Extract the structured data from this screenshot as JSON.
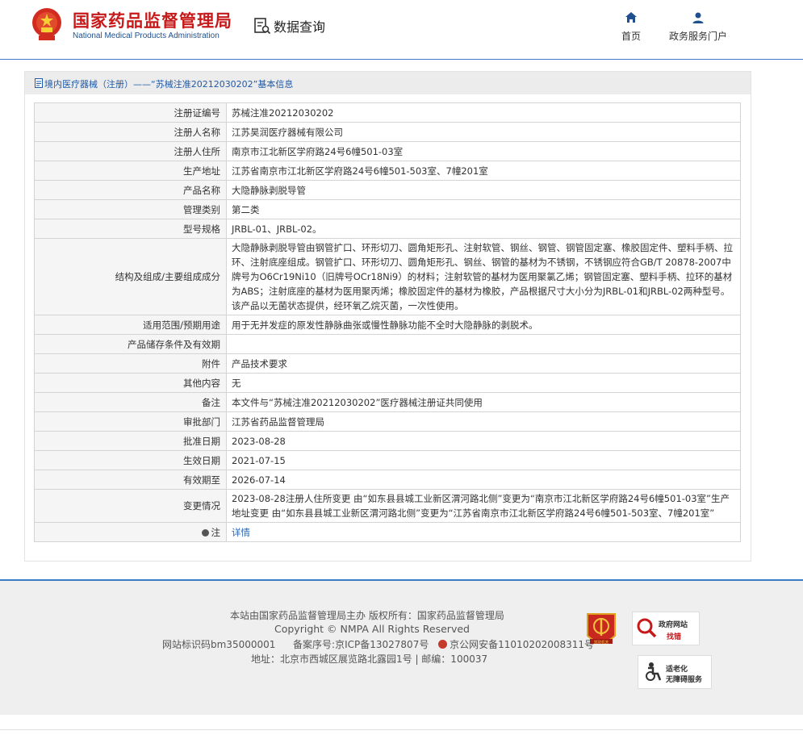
{
  "header": {
    "logo_cn": "国家药品监督管理局",
    "logo_en": "National Medical Products Administration",
    "section_label": "数据查询",
    "nav": [
      {
        "label": "首页",
        "icon": "home-icon"
      },
      {
        "label": "政务服务门户",
        "icon": "user-icon"
      }
    ]
  },
  "panel": {
    "title": "境内医疗器械（注册）——“苏械注准20212030202”基本信息"
  },
  "rows": [
    {
      "label": "注册证编号",
      "value": "苏械注准20212030202"
    },
    {
      "label": "注册人名称",
      "value": "江苏昊润医疗器械有限公司"
    },
    {
      "label": "注册人住所",
      "value": "南京市江北新区学府路24号6幢501-03室"
    },
    {
      "label": "生产地址",
      "value": "江苏省南京市江北新区学府路24号6幢501-503室、7幢201室"
    },
    {
      "label": "产品名称",
      "value": "大隐静脉剥脱导管"
    },
    {
      "label": "管理类别",
      "value": "第二类"
    },
    {
      "label": "型号规格",
      "value": "JRBL-01、JRBL-02。"
    },
    {
      "label": "结构及组成/主要组成成分",
      "value": "大隐静脉剥脱导管由钢管扩口、环形切刀、圆角矩形孔、注射软管、钢丝、钢管、钢管固定塞、橡胶固定件、塑料手柄、拉环、注射底座组成。钢管扩口、环形切刀、圆角矩形孔、钢丝、钢管的基材为不锈钢，不锈钢应符合GB/T 20878-2007中牌号为O6Cr19Ni10（旧牌号OCr18Ni9）的材料；注射软管的基材为医用聚氯乙烯；钢管固定塞、塑料手柄、拉环的基材为ABS；注射底座的基材为医用聚丙烯；橡胶固定件的基材为橡胶，产品根据尺寸大小分为JRBL-01和JRBL-02两种型号。该产品以无菌状态提供，经环氧乙烷灭菌，一次性使用。"
    },
    {
      "label": "适用范围/预期用途",
      "value": "用于无并发症的原发性静脉曲张或慢性静脉功能不全时大隐静脉的剥脱术。"
    },
    {
      "label": "产品储存条件及有效期",
      "value": ""
    },
    {
      "label": "附件",
      "value": "产品技术要求"
    },
    {
      "label": "其他内容",
      "value": "无"
    },
    {
      "label": "备注",
      "value": "本文件与“苏械注准20212030202”医疗器械注册证共同使用"
    },
    {
      "label": "审批部门",
      "value": "江苏省药品监督管理局"
    },
    {
      "label": "批准日期",
      "value": "2023-08-28"
    },
    {
      "label": "生效日期",
      "value": "2021-07-15"
    },
    {
      "label": "有效期至",
      "value": "2026-07-14"
    },
    {
      "label": "变更情况",
      "value": "2023-08-28注册人住所变更 由“如东县县城工业新区渭河路北侧”变更为“南京市江北新区学府路24号6幢501-03室”生产地址变更 由“如东县县城工业新区渭河路北侧”变更为“江苏省南京市江北新区学府路24号6幢501-503室、7幢201室”"
    }
  ],
  "note": {
    "label": "注",
    "value": "详情"
  },
  "footer": {
    "line1": "本站由国家药品监督管理局主办 版权所有：国家药品监督管理局",
    "line2": "Copyright © NMPA All Rights Reserved",
    "site_id": "网站标识码bm35000001",
    "icp": "备案序号:京ICP备13027807号",
    "police": "京公网安备11010202008311号",
    "address": "地址：北京市西城区展览路北露园1号 | 邮编：100037",
    "badge_zhaocuo_title": "政府网站",
    "badge_zhaocuo_sub": "找错",
    "badge_shilao_title": "适老化",
    "badge_shilao_sub": "无障碍服务",
    "badge_dang": "党政机关"
  },
  "colors": {
    "brand_red": "#c7191a",
    "brand_blue": "#1f4f8e",
    "link_blue": "#2466b8",
    "divider_blue": "#3b7cc4"
  }
}
